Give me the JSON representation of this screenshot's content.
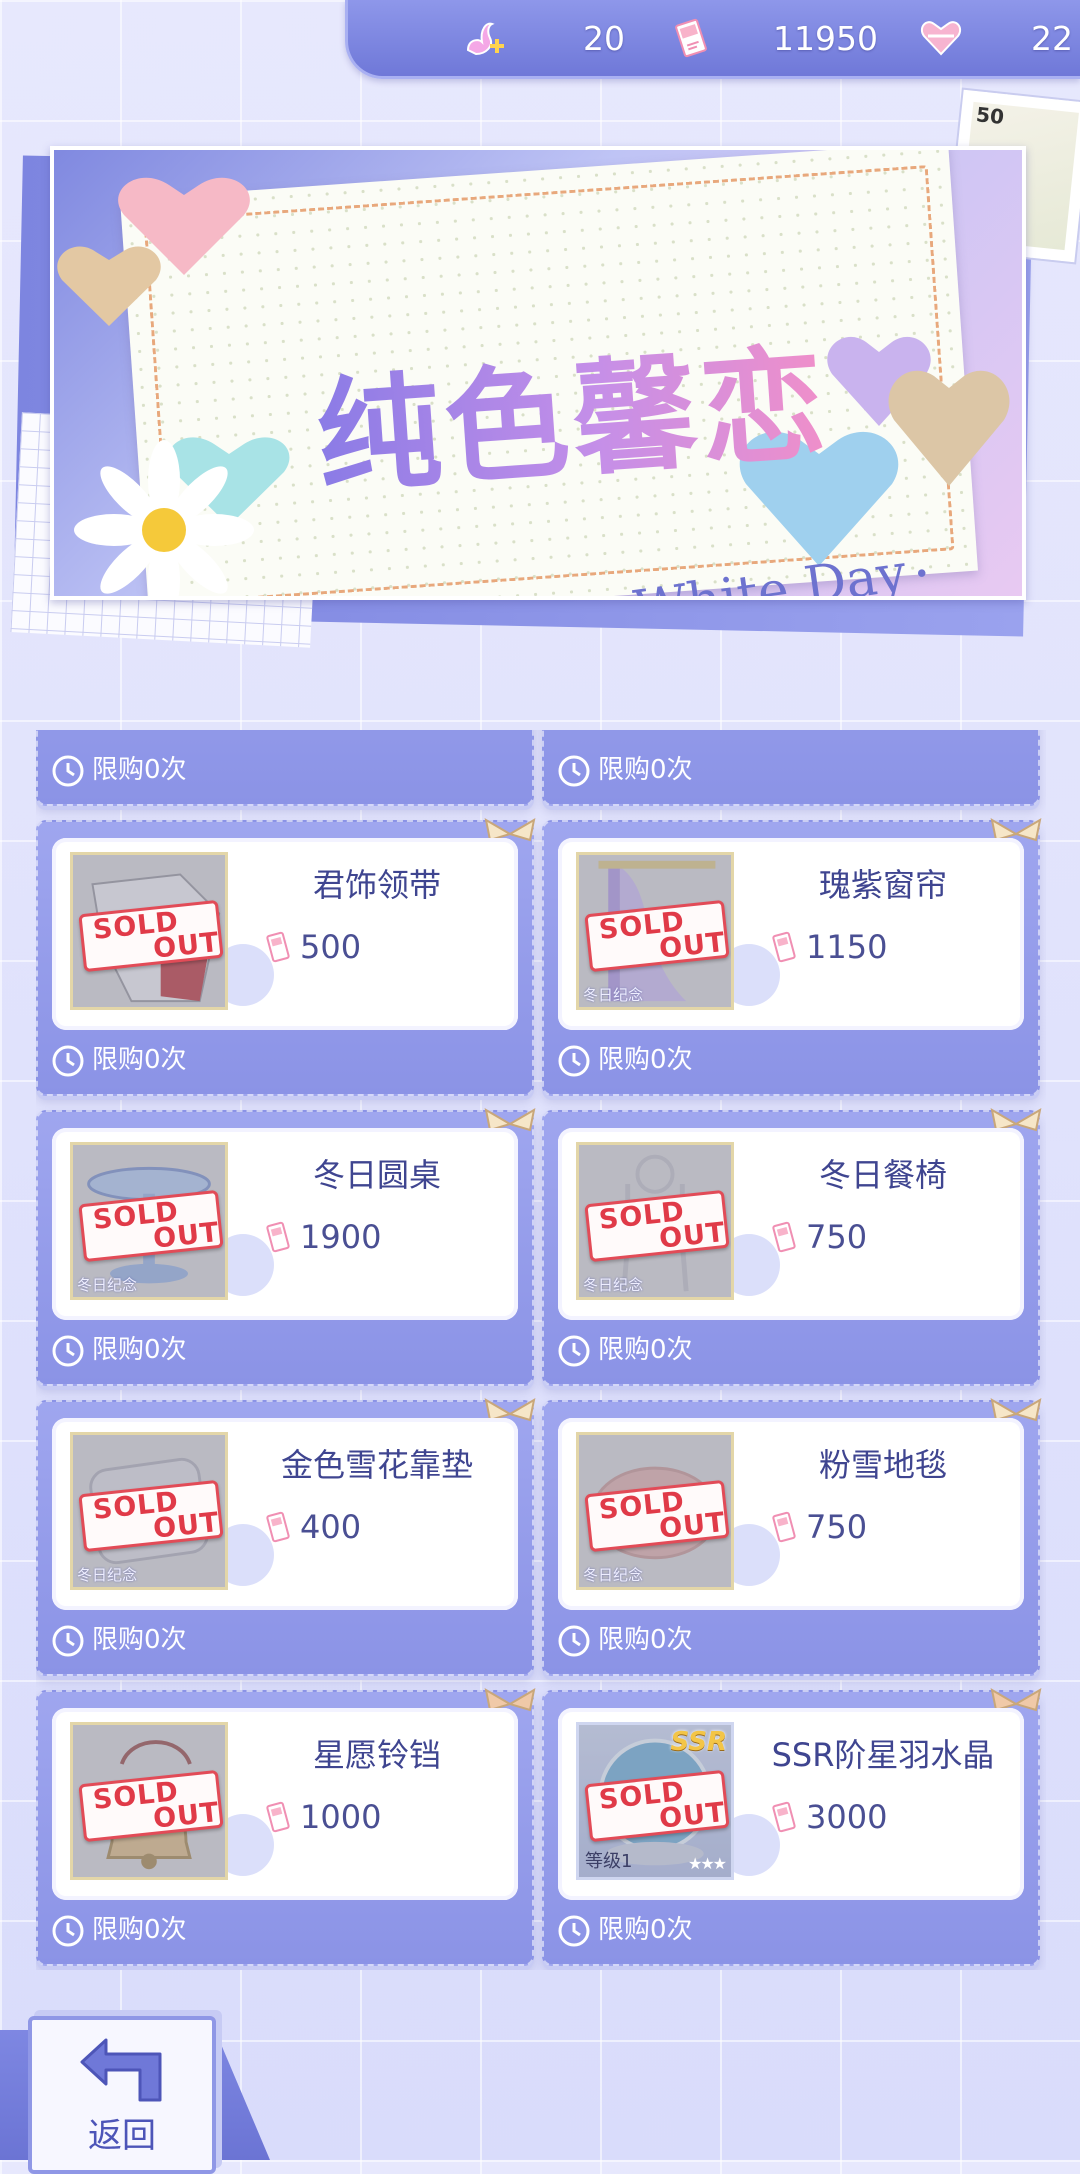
{
  "currencies": [
    {
      "icon": "swan-plus-icon",
      "value": "20"
    },
    {
      "icon": "love-letter-ticket-icon",
      "value": "11950"
    },
    {
      "icon": "heart-gift-icon",
      "value": "22"
    }
  ],
  "banner": {
    "title": "纯色馨恋",
    "subtitle": "White Day",
    "stamp_number": "50"
  },
  "shop": {
    "limit_label": "限购0次",
    "sold_out_line1": "SOLD",
    "sold_out_line2": "OUT",
    "tag_text": "冬日纪念",
    "items": [
      {
        "name": "君饰领带",
        "price": "500",
        "tag": false,
        "art": "tie"
      },
      {
        "name": "瑰紫窗帘",
        "price": "1150",
        "tag": true,
        "art": "curtain"
      },
      {
        "name": "冬日圆桌",
        "price": "1900",
        "tag": true,
        "art": "table"
      },
      {
        "name": "冬日餐椅",
        "price": "750",
        "tag": true,
        "art": "chair"
      },
      {
        "name": "金色雪花靠垫",
        "price": "400",
        "tag": true,
        "art": "cushion"
      },
      {
        "name": "粉雪地毯",
        "price": "750",
        "tag": true,
        "art": "rug"
      },
      {
        "name": "星愿铃铛",
        "price": "1000",
        "tag": false,
        "art": "bell"
      },
      {
        "name": "SSR阶星羽水晶",
        "price": "3000",
        "tag": false,
        "art": "crystal",
        "badge": "SSR",
        "level": "等级1"
      }
    ]
  },
  "back_button": {
    "label": "返回"
  },
  "colors": {
    "accent": "#7b83de",
    "text": "#3f4590",
    "sold_out": "#e03a48"
  }
}
